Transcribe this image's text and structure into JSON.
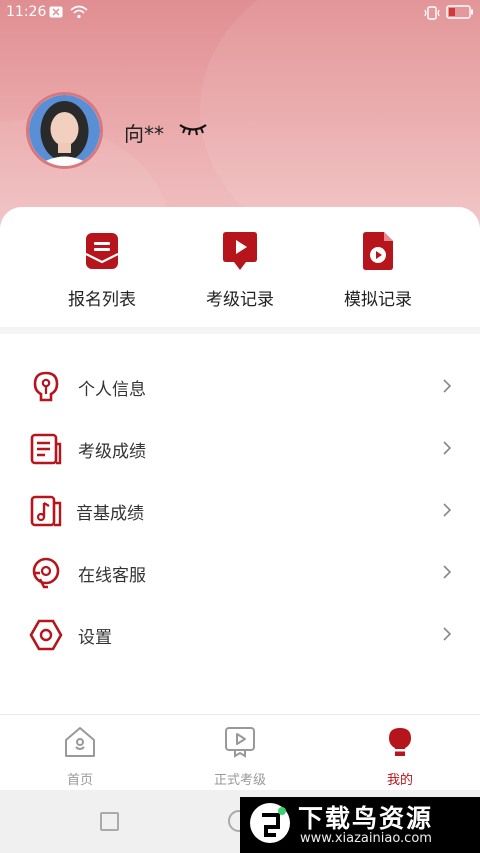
{
  "status_bar": {
    "time": "11:26"
  },
  "profile": {
    "name": "向**"
  },
  "quick_actions": [
    {
      "label": "报名列表",
      "icon": "envelope-list-icon"
    },
    {
      "label": "考级记录",
      "icon": "play-ribbon-icon"
    },
    {
      "label": "模拟记录",
      "icon": "video-file-icon"
    }
  ],
  "menu": [
    {
      "label": "个人信息",
      "icon": "person-bulb-icon"
    },
    {
      "label": "考级成绩",
      "icon": "document-list-icon"
    },
    {
      "label": "音基成绩",
      "icon": "music-note-icon"
    },
    {
      "label": "在线客服",
      "icon": "headset-icon"
    },
    {
      "label": "设置",
      "icon": "hexagon-settings-icon"
    }
  ],
  "tabs": [
    {
      "label": "首页",
      "icon": "home-icon",
      "active": false
    },
    {
      "label": "正式考级",
      "icon": "video-play-icon",
      "active": false
    },
    {
      "label": "我的",
      "icon": "profile-icon",
      "active": true
    }
  ],
  "watermark": {
    "title": "下载鸟资源",
    "url": "www.xiazainiao.com"
  },
  "colors": {
    "accent": "#b5151b",
    "header": "#e9a3a5"
  }
}
